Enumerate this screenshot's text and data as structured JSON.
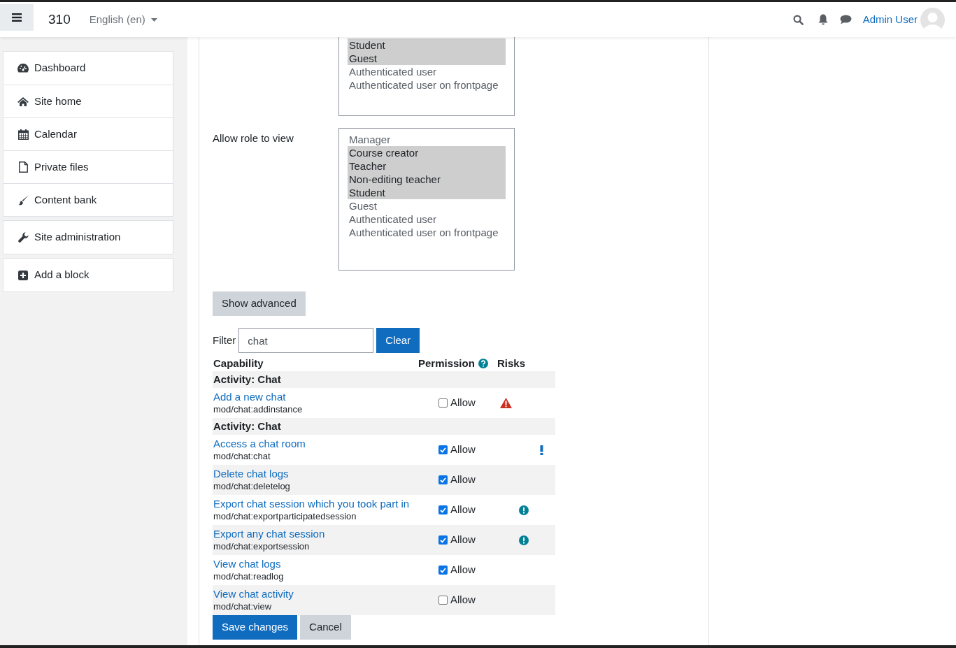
{
  "navbar": {
    "site_name": "310",
    "language": "English (en)",
    "user_name": "Admin User"
  },
  "sidebar": {
    "groups": [
      [
        {
          "label": "Dashboard",
          "kind": "dashboard"
        },
        {
          "label": "Site home",
          "kind": "home"
        },
        {
          "label": "Calendar",
          "kind": "calendar"
        },
        {
          "label": "Private files",
          "kind": "file"
        },
        {
          "label": "Content bank",
          "kind": "brush"
        }
      ],
      [
        {
          "label": "Site administration",
          "kind": "wrench"
        }
      ],
      [
        {
          "label": "Add a block",
          "kind": "add"
        }
      ]
    ]
  },
  "role_lists": [
    {
      "options": [
        {
          "label": "Student",
          "selected": true
        },
        {
          "label": "Guest",
          "selected": true
        },
        {
          "label": "Authenticated user",
          "selected": false
        },
        {
          "label": "Authenticated user on frontpage",
          "selected": false
        }
      ]
    },
    {
      "label": "Allow role to view",
      "options": [
        {
          "label": "Manager",
          "selected": false
        },
        {
          "label": "Course creator",
          "selected": true
        },
        {
          "label": "Teacher",
          "selected": true
        },
        {
          "label": "Non-editing teacher",
          "selected": true
        },
        {
          "label": "Student",
          "selected": true
        },
        {
          "label": "Guest",
          "selected": false
        },
        {
          "label": "Authenticated user",
          "selected": false
        },
        {
          "label": "Authenticated user on frontpage",
          "selected": false
        }
      ]
    }
  ],
  "show_advanced_button": "Show advanced",
  "filter": {
    "label": "Filter",
    "value": "chat",
    "clear_button": "Clear"
  },
  "table": {
    "columns": [
      "Capability",
      "Permission",
      "Risks"
    ],
    "groups": [
      {
        "title": "Activity: Chat",
        "rows": [
          {
            "name": "Add a new chat",
            "capability": "mod/chat:addinstance",
            "permission": "Allow",
            "checked": false,
            "risk": {
              "kind": "xss"
            }
          }
        ]
      },
      {
        "title": "Activity: Chat",
        "rows": [
          {
            "name": "Access a chat room",
            "capability": "mod/chat:chat",
            "permission": "Allow",
            "checked": true,
            "risk": {
              "kind": "spam"
            }
          },
          {
            "name": "Delete chat logs",
            "capability": "mod/chat:deletelog",
            "permission": "Allow",
            "checked": true
          },
          {
            "name": "Export chat session which you took part in",
            "capability": "mod/chat:exportparticipatedsession",
            "permission": "Allow",
            "checked": true,
            "risk": {
              "kind": "personal"
            }
          },
          {
            "name": "Export any chat session",
            "capability": "mod/chat:exportsession",
            "permission": "Allow",
            "checked": true,
            "risk": {
              "kind": "personal"
            }
          },
          {
            "name": "View chat logs",
            "capability": "mod/chat:readlog",
            "permission": "Allow",
            "checked": true
          },
          {
            "name": "View chat activity",
            "capability": "mod/chat:view",
            "permission": "Allow",
            "checked": false
          }
        ]
      }
    ]
  },
  "buttons": {
    "save": "Save changes",
    "cancel": "Cancel"
  }
}
